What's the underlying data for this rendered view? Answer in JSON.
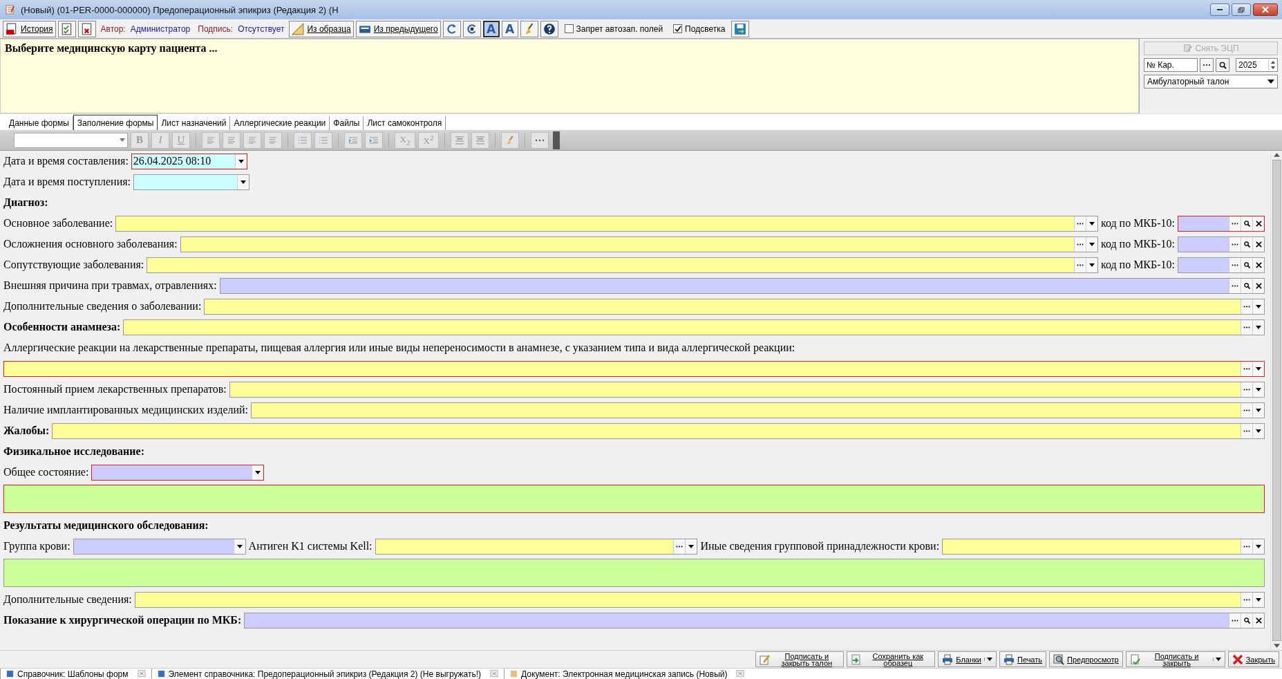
{
  "window": {
    "title": "(Новый) (01-PER-0000-000000) Предоперационный эпикриз (Редакция 2) (Н"
  },
  "toolbar": {
    "history": "История",
    "author_caption": "Автор:",
    "author": "Администратор",
    "signature_caption": "Подпись:",
    "signature": "Отсутствует",
    "from_template": "Из образца",
    "from_previous": "Из предыдущего",
    "font_glyphs": [
      {
        "label": "A",
        "selected": true
      },
      {
        "label": "A",
        "selected": false
      }
    ],
    "checkboxes": [
      {
        "label": "Запрет автозап. полей",
        "checked": false
      },
      {
        "label": "Подсветка",
        "checked": true
      }
    ]
  },
  "header": {
    "prompt": "Выберите медицинскую карту пациента ...",
    "remove_signature": {
      "label": "Снять ЭЦП",
      "disabled": true
    },
    "card": {
      "placeholder": "№ Кар."
    },
    "year": "2025",
    "document_type": "Амбулаторный талон"
  },
  "tabs": [
    {
      "label": "Данные формы",
      "selected": false
    },
    {
      "label": "Заполнение формы",
      "selected": true
    },
    {
      "label": "Лист назначений",
      "selected": false
    },
    {
      "label": "Аллергические реакции",
      "selected": false
    },
    {
      "label": "Файлы",
      "selected": false
    },
    {
      "label": "Лист самоконтроля",
      "selected": false
    }
  ],
  "format_toolbar": {
    "styles": [
      "B",
      "I",
      "U"
    ],
    "scripts": [
      "X$_{2}$",
      "X$^{2}$"
    ]
  },
  "form": {
    "rows": [
      {
        "items": [
          {
            "kind": "plain",
            "label": "Дата и время составления:",
            "field": {
              "kind": "date",
              "color": "#ccffff",
              "required": true,
              "value": "26.04.2025 08:10"
            }
          }
        ]
      },
      {
        "items": [
          {
            "kind": "plain",
            "label": "Дата и время поступления:",
            "field": {
              "kind": "date",
              "color": "#ccffff",
              "required": false
            }
          }
        ]
      },
      {
        "items": [
          {
            "kind": "heading",
            "label": "Диагноз:"
          }
        ]
      },
      {
        "items": [
          {
            "kind": "plain",
            "label": "Основное заболевание:",
            "field": {
              "kind": "text",
              "color": "#ffff99",
              "required": false
            }
          },
          {
            "kind": "plain",
            "label": "код по МКБ-10:",
            "field": {
              "kind": "code",
              "color": "#ccccff",
              "required": true
            }
          }
        ]
      },
      {
        "items": [
          {
            "kind": "plain",
            "label": "Осложнения основного заболевания:",
            "field": {
              "kind": "text",
              "color": "#ffff99",
              "required": false
            }
          },
          {
            "kind": "plain",
            "label": "код по МКБ-10:",
            "field": {
              "kind": "code",
              "color": "#ccccff",
              "required": false
            }
          }
        ]
      },
      {
        "items": [
          {
            "kind": "plain",
            "label": "Сопутствующие заболевания:",
            "field": {
              "kind": "text",
              "color": "#ffff99",
              "required": false
            }
          },
          {
            "kind": "plain",
            "label": "код по МКБ-10:",
            "field": {
              "kind": "code",
              "color": "#ccccff",
              "required": false
            }
          }
        ]
      },
      {
        "items": [
          {
            "kind": "plain",
            "label": "Внешняя причина при травмах, отравлениях:",
            "field": {
              "kind": "code",
              "color": "#ccccff",
              "required": false
            }
          }
        ]
      },
      {
        "items": [
          {
            "kind": "plain",
            "label": "Дополнительные сведения о заболевании:",
            "field": {
              "kind": "text",
              "color": "#ffff99",
              "required": false
            }
          }
        ]
      },
      {
        "items": [
          {
            "kind": "heading",
            "label": "Особенности анамнеза:",
            "field": {
              "kind": "text",
              "color": "#ffff99",
              "required": false
            }
          }
        ]
      },
      {
        "items": [
          {
            "kind": "plain",
            "label": "Аллергические реакции на лекарственные препараты, пищевая аллергия или иные виды непереносимости в анамнезе, с указанием типа и вида аллергической реакции:"
          }
        ]
      },
      {
        "items": [
          {
            "field": {
              "kind": "text",
              "color": "#ffff99",
              "required": true
            }
          }
        ]
      },
      {
        "items": [
          {
            "kind": "plain",
            "label": "Постоянный прием лекарственных препаратов:",
            "field": {
              "kind": "text",
              "color": "#ffff99",
              "required": false
            }
          }
        ]
      },
      {
        "items": [
          {
            "kind": "plain",
            "label": "Наличие имплантированных медицинских изделий:",
            "field": {
              "kind": "text",
              "color": "#ffff99",
              "required": false
            }
          }
        ]
      },
      {
        "items": [
          {
            "kind": "heading",
            "label": "Жалобы:",
            "field": {
              "kind": "text",
              "color": "#ffff99",
              "required": false
            }
          }
        ]
      },
      {
        "items": [
          {
            "kind": "heading",
            "label": "Физикальное исследование:"
          }
        ]
      },
      {
        "items": [
          {
            "kind": "plain",
            "label": "Общее состояние:",
            "field": {
              "kind": "combo",
              "color": "#ccccff",
              "required": true
            }
          }
        ]
      },
      {
        "items": [
          {
            "field": {
              "kind": "memo",
              "color": "#ccff99",
              "required": true
            }
          }
        ]
      },
      {
        "items": [
          {
            "kind": "heading",
            "label": "Результаты медицинского обследования:"
          }
        ]
      },
      {
        "items": [
          {
            "kind": "plain",
            "label": "Группа крови:",
            "field": {
              "kind": "combo",
              "color": "#ccccff",
              "required": false
            }
          },
          {
            "kind": "plain",
            "label": "Антиген K1 системы Kell:",
            "field": {
              "kind": "text",
              "color": "#ffff99",
              "required": false
            }
          },
          {
            "kind": "plain",
            "label": "Иные сведения групповой принадлежности крови:",
            "field": {
              "kind": "text",
              "color": "#ffff99",
              "required": false
            }
          }
        ]
      },
      {
        "items": [
          {
            "field": {
              "kind": "memo",
              "color": "#ccff99",
              "required": false
            }
          }
        ]
      },
      {
        "items": [
          {
            "kind": "plain",
            "label": "Дополнительные сведения:",
            "field": {
              "kind": "text",
              "color": "#ffff99",
              "required": false
            }
          }
        ]
      },
      {
        "items": [
          {
            "kind": "heading",
            "label": "Показание к хирургической операции по МКБ:",
            "field": {
              "kind": "code",
              "color": "#ccccff",
              "required": false
            }
          }
        ]
      }
    ]
  },
  "actions": [
    {
      "label": "Подписать и закрыть талон",
      "has_menu": false
    },
    {
      "label": "Сохранить как образец",
      "has_menu": false
    },
    {
      "label": "Бланки",
      "has_menu": true
    },
    {
      "label": "Печать",
      "has_menu": false
    },
    {
      "label": "Предпросмотр",
      "has_menu": false
    },
    {
      "label": "Подписать и закрыть",
      "has_menu": true
    },
    {
      "label": "Закрыть",
      "has_menu": false
    }
  ],
  "taskbar": [
    {
      "label": "Справочник: Шаблоны форм"
    },
    {
      "label": "Элемент справочника: Предоперационный эпикриз (Редакция 2) (Не выгружать!)"
    },
    {
      "label": "Документ: Электронная медицинская запись (Новый)"
    }
  ]
}
